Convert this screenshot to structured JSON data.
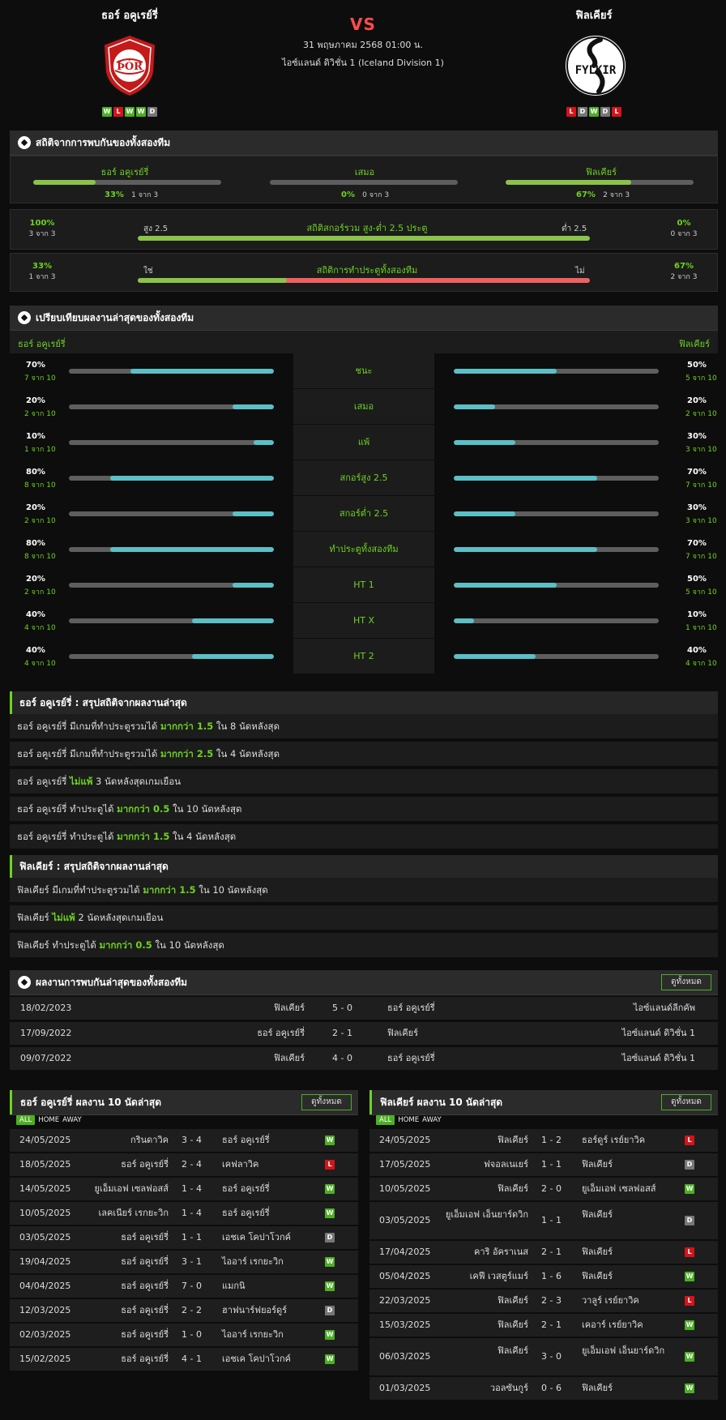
{
  "header": {
    "home": {
      "name": "ธอร์ อคูเรย์รี่",
      "form": [
        "W",
        "L",
        "W",
        "W",
        "D"
      ],
      "logo_text": "ÞÓR"
    },
    "away": {
      "name": "ฟิลเคียร์",
      "form": [
        "L",
        "D",
        "W",
        "D",
        "L"
      ],
      "logo_text": "FYLKIR"
    },
    "vs": "VS",
    "datetime": "31 พฤษภาคม 2568 01:00 น.",
    "league": "ไอซ์แลนด์ ดิวิชั่น 1 (Iceland Division 1)"
  },
  "h2h_stats": {
    "title": "สถิติจากการพบกันของทั้งสองทีม",
    "home": {
      "label": "ธอร์ อคูเรย์รี่",
      "pct": "33%",
      "count": "1 จาก 3",
      "value": 33
    },
    "draw": {
      "label": "เสมอ",
      "pct": "0%",
      "count": "0 จาก 3",
      "value": 0
    },
    "away": {
      "label": "ฟิลเคียร์",
      "pct": "67%",
      "count": "2 จาก 3",
      "value": 67
    },
    "goals": {
      "title": "สถิติสกอร์รวม สูง-ต่ำ 2.5 ประตู",
      "left_pct": "100%",
      "left_count": "3 จาก 3",
      "left_label": "สูง 2.5",
      "right_label": "ต่ำ 2.5",
      "right_pct": "0%",
      "right_count": "0 จาก 3",
      "value": 100
    },
    "btts": {
      "title": "สถิติการทำประตูทั้งสองทีม",
      "left_pct": "33%",
      "left_count": "1 จาก 3",
      "left_label": "ใช่",
      "right_label": "ไม่",
      "right_pct": "67%",
      "right_count": "2 จาก 3",
      "value": 33
    }
  },
  "compare": {
    "title": "เปรียบเทียบผลงานล่าสุดของทั้งสองทีม",
    "home": "ธอร์ อคูเรย์รี่",
    "away": "ฟิลเคียร์",
    "rows": [
      {
        "label": "ชนะ",
        "hp": "70%",
        "hc": "7 จาก 10",
        "hv": 70,
        "ap": "50%",
        "ac": "5 จาก 10",
        "av": 50
      },
      {
        "label": "เสมอ",
        "hp": "20%",
        "hc": "2 จาก 10",
        "hv": 20,
        "ap": "20%",
        "ac": "2 จาก 10",
        "av": 20
      },
      {
        "label": "แพ้",
        "hp": "10%",
        "hc": "1 จาก 10",
        "hv": 10,
        "ap": "30%",
        "ac": "3 จาก 10",
        "av": 30
      },
      {
        "label": "สกอร์สูง 2.5",
        "hp": "80%",
        "hc": "8 จาก 10",
        "hv": 80,
        "ap": "70%",
        "ac": "7 จาก 10",
        "av": 70
      },
      {
        "label": "สกอร์ต่ำ 2.5",
        "hp": "20%",
        "hc": "2 จาก 10",
        "hv": 20,
        "ap": "30%",
        "ac": "3 จาก 10",
        "av": 30
      },
      {
        "label": "ทำประตูทั้งสองทีม",
        "hp": "80%",
        "hc": "8 จาก 10",
        "hv": 80,
        "ap": "70%",
        "ac": "7 จาก 10",
        "av": 70
      },
      {
        "label": "HT 1",
        "hp": "20%",
        "hc": "2 จาก 10",
        "hv": 20,
        "ap": "50%",
        "ac": "5 จาก 10",
        "av": 50
      },
      {
        "label": "HT X",
        "hp": "40%",
        "hc": "4 จาก 10",
        "hv": 40,
        "ap": "10%",
        "ac": "1 จาก 10",
        "av": 10
      },
      {
        "label": "HT 2",
        "hp": "40%",
        "hc": "4 จาก 10",
        "hv": 40,
        "ap": "40%",
        "ac": "4 จาก 10",
        "av": 40
      }
    ]
  },
  "home_summary": {
    "title": "ธอร์ อคูเรย์รี่ : สรุปสถิติจากผลงานล่าสุด",
    "lines": [
      {
        "pre": "ธอร์ อคูเรย์รี่  มีเกมที่ทำประตูรวมได้ ",
        "hl": "มากกว่า  1.5",
        "post": "  ใน 8 นัดหลังสุด"
      },
      {
        "pre": "ธอร์ อคูเรย์รี่  มีเกมที่ทำประตูรวมได้ ",
        "hl": "มากกว่า  2.5",
        "post": "  ใน 4 นัดหลังสุด"
      },
      {
        "pre": "ธอร์ อคูเรย์รี่ ",
        "hl": "ไม่แพ้",
        "post": "  3  นัดหลังสุดเกมเยือน"
      },
      {
        "pre": "ธอร์ อคูเรย์รี่  ทำประตูได้ ",
        "hl": "มากกว่า  0.5",
        "post": "  ใน 10 นัดหลังสุด"
      },
      {
        "pre": "ธอร์ อคูเรย์รี่  ทำประตูได้ ",
        "hl": "มากกว่า  1.5",
        "post": "  ใน 4 นัดหลังสุด"
      }
    ]
  },
  "away_summary": {
    "title": "ฟิลเคียร์ : สรุปสถิติจากผลงานล่าสุด",
    "lines": [
      {
        "pre": "ฟิลเคียร์  มีเกมที่ทำประตูรวมได้ ",
        "hl": "มากกว่า  1.5",
        "post": "  ใน 10 นัดหลังสุด"
      },
      {
        "pre": "ฟิลเคียร์ ",
        "hl": "ไม่แพ้",
        "post": "  2  นัดหลังสุดเกมเยือน"
      },
      {
        "pre": "ฟิลเคียร์  ทำประตูได้ ",
        "hl": "มากกว่า  0.5",
        "post": "  ใน 10 นัดหลังสุด"
      }
    ]
  },
  "h2h_results": {
    "title": "ผลงานการพบกันล่าสุดของทั้งสองทีม",
    "button": "ดูทั้งหมด",
    "rows": [
      {
        "date": "18/02/2023",
        "home": "ฟิลเคียร์",
        "score": "5 - 0",
        "away": "ธอร์ อคูเรย์รี่",
        "comp": "ไอซ์แลนด์ลีกคัพ"
      },
      {
        "date": "17/09/2022",
        "home": "ธอร์ อคูเรย์รี่",
        "score": "2 - 1",
        "away": "ฟิลเคียร์",
        "comp": "ไอซ์แลนด์ ดิวิชั่น 1"
      },
      {
        "date": "09/07/2022",
        "home": "ฟิลเคียร์",
        "score": "4 - 0",
        "away": "ธอร์ อคูเรย์รี่",
        "comp": "ไอซ์แลนด์ ดิวิชั่น 1"
      }
    ]
  },
  "tabs": [
    "ALL",
    "HOME",
    "AWAY"
  ],
  "home_last10": {
    "title": "ธอร์ อคูเรย์รี่ ผลงาน 10 นัดล่าสุด",
    "button": "ดูทั้งหมด",
    "rows": [
      {
        "date": "24/05/2025",
        "home": "กรินดาวิค",
        "score": "3 - 4",
        "away": "ธอร์ อคูเรย์รี่",
        "res": "W"
      },
      {
        "date": "18/05/2025",
        "home": "ธอร์ อคูเรย์รี่",
        "score": "2 - 4",
        "away": "เคฟลาวิค",
        "res": "L"
      },
      {
        "date": "14/05/2025",
        "home": "ยูเอ็มเอฟ เซลฟอสส์",
        "score": "1 - 4",
        "away": "ธอร์ อคูเรย์รี่",
        "res": "W"
      },
      {
        "date": "10/05/2025",
        "home": "เลคเนียร์ เรกยะวิก",
        "score": "1 - 4",
        "away": "ธอร์ อคูเรย์รี่",
        "res": "W"
      },
      {
        "date": "03/05/2025",
        "home": "ธอร์ อคูเรย์รี่",
        "score": "1 - 1",
        "away": "เอชเค โคปาโวกค์",
        "res": "D"
      },
      {
        "date": "19/04/2025",
        "home": "ธอร์ อคูเรย์รี่",
        "score": "3 - 1",
        "away": "ไออาร์ เรกยะวิก",
        "res": "W"
      },
      {
        "date": "04/04/2025",
        "home": "ธอร์ อคูเรย์รี่",
        "score": "7 - 0",
        "away": "แมกนิ",
        "res": "W"
      },
      {
        "date": "12/03/2025",
        "home": "ธอร์ อคูเรย์รี่",
        "score": "2 - 2",
        "away": "ฮาฟนาร์ฟยอร์ดูร์",
        "res": "D"
      },
      {
        "date": "02/03/2025",
        "home": "ธอร์ อคูเรย์รี่",
        "score": "1 - 0",
        "away": "ไออาร์ เรกยะวิก",
        "res": "W"
      },
      {
        "date": "15/02/2025",
        "home": "ธอร์ อคูเรย์รี่",
        "score": "4 - 1",
        "away": "เอชเค โคปาโวกค์",
        "res": "W"
      }
    ]
  },
  "away_last10": {
    "title": "ฟิลเคียร์ ผลงาน 10 นัดล่าสุด",
    "button": "ดูทั้งหมด",
    "rows": [
      {
        "date": "24/05/2025",
        "home": "ฟิลเคียร์",
        "score": "1 - 2",
        "away": "ธอร์ดูร์ เรย์ยาวิค",
        "res": "L"
      },
      {
        "date": "17/05/2025",
        "home": "ฟจอลเนเยร์",
        "score": "1 - 1",
        "away": "ฟิลเคียร์",
        "res": "D"
      },
      {
        "date": "10/05/2025",
        "home": "ฟิลเคียร์",
        "score": "2 - 0",
        "away": "ยูเอ็มเอฟ เซลฟอสส์",
        "res": "W"
      },
      {
        "date": "03/05/2025",
        "home": "ยูเอ็มเอฟ เอ็นยาร์ดวิก",
        "score": "1 - 1",
        "away": "ฟิลเคียร์",
        "res": "D"
      },
      {
        "date": "17/04/2025",
        "home": "คาริ อัคราเนส",
        "score": "2 - 1",
        "away": "ฟิลเคียร์",
        "res": "L"
      },
      {
        "date": "05/04/2025",
        "home": "เคฟี เวสตูร์แมร์",
        "score": "1 - 6",
        "away": "ฟิลเคียร์",
        "res": "W"
      },
      {
        "date": "22/03/2025",
        "home": "ฟิลเคียร์",
        "score": "2 - 3",
        "away": "วาลูร์ เรย์ยาวิค",
        "res": "L"
      },
      {
        "date": "15/03/2025",
        "home": "ฟิลเคียร์",
        "score": "2 - 1",
        "away": "เคอาร์ เรย์ยาวิค",
        "res": "W"
      },
      {
        "date": "06/03/2025",
        "home": "ฟิลเคียร์",
        "score": "3 - 0",
        "away": "ยูเอ็มเอฟ เอ็นยาร์ดวิก",
        "res": "W"
      },
      {
        "date": "01/03/2025",
        "home": "วอลซันกูร์",
        "score": "0 - 6",
        "away": "ฟิลเคียร์",
        "res": "W"
      }
    ]
  },
  "colors": {
    "accent": "#6ed320",
    "win": "#4caf24",
    "loss": "#d3141a",
    "draw": "#777777",
    "cyan": "#5bbfc6",
    "red": "#f06060"
  }
}
